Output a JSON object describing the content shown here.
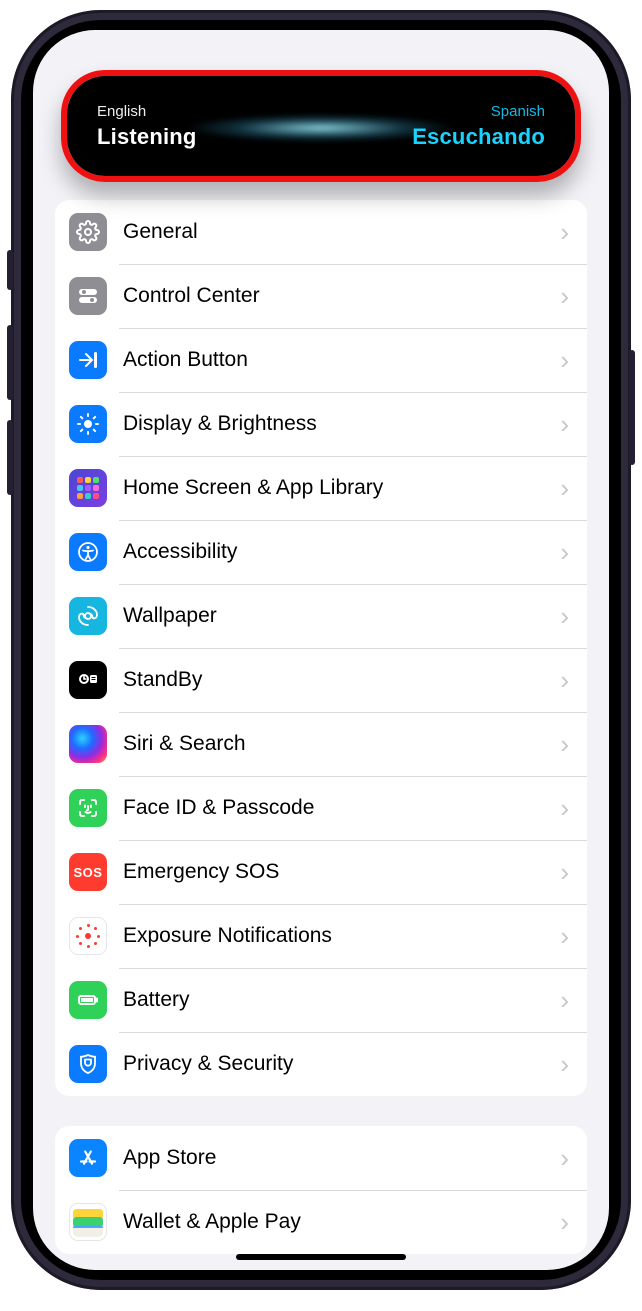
{
  "translate": {
    "source_lang": "English",
    "source_status": "Listening",
    "target_lang": "Spanish",
    "target_status": "Escuchando"
  },
  "group1": {
    "items": [
      {
        "id": "general",
        "label": "General"
      },
      {
        "id": "control-center",
        "label": "Control Center"
      },
      {
        "id": "action-button",
        "label": "Action Button"
      },
      {
        "id": "display",
        "label": "Display & Brightness"
      },
      {
        "id": "home-screen",
        "label": "Home Screen & App Library"
      },
      {
        "id": "accessibility",
        "label": "Accessibility"
      },
      {
        "id": "wallpaper",
        "label": "Wallpaper"
      },
      {
        "id": "standby",
        "label": "StandBy"
      },
      {
        "id": "siri",
        "label": "Siri & Search"
      },
      {
        "id": "faceid",
        "label": "Face ID & Passcode"
      },
      {
        "id": "sos",
        "label": "Emergency SOS"
      },
      {
        "id": "exposure",
        "label": "Exposure Notifications"
      },
      {
        "id": "battery",
        "label": "Battery"
      },
      {
        "id": "privacy",
        "label": "Privacy & Security"
      }
    ]
  },
  "group2": {
    "items": [
      {
        "id": "app-store",
        "label": "App Store"
      },
      {
        "id": "wallet",
        "label": "Wallet & Apple Pay"
      }
    ]
  },
  "sos_text": "SOS"
}
